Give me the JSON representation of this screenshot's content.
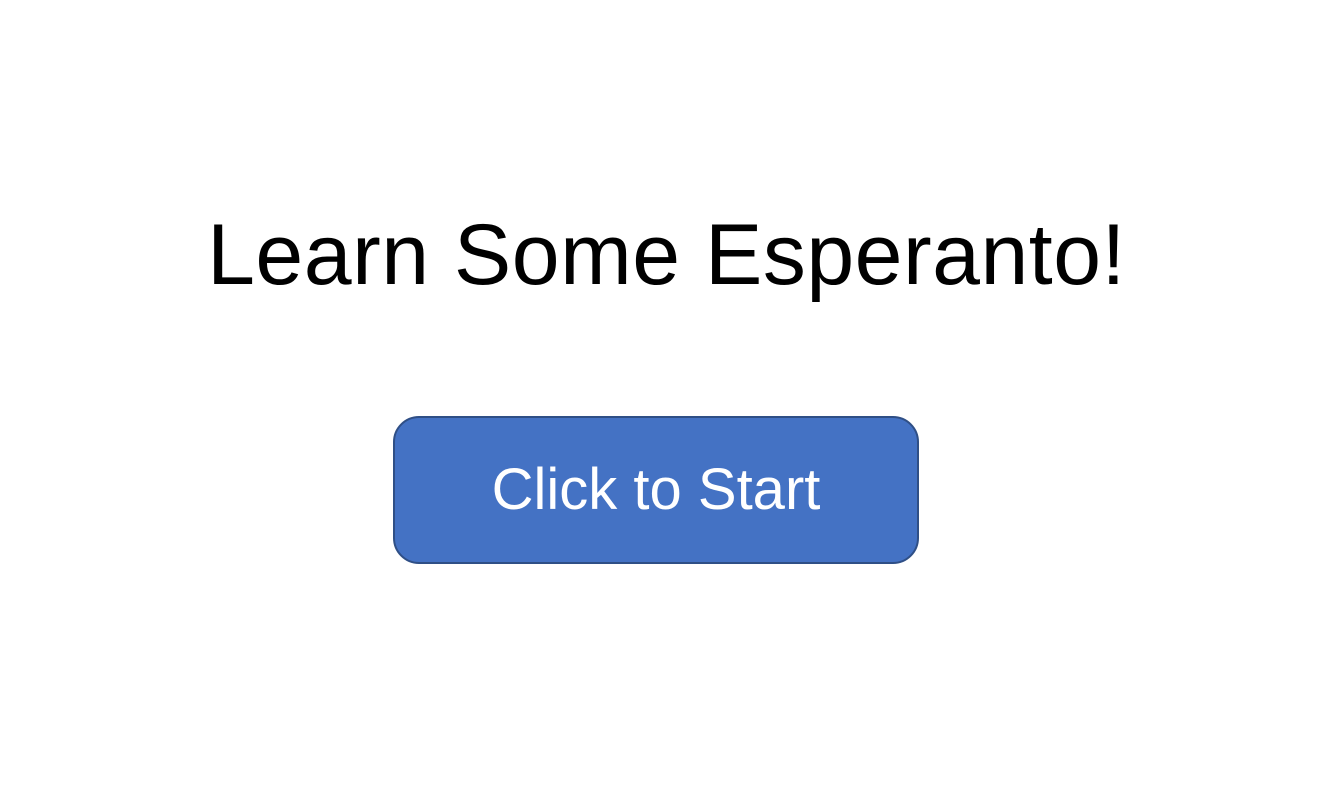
{
  "slide": {
    "title": "Learn Some Esperanto!",
    "start_button_label": "Click to Start"
  },
  "colors": {
    "background": "#ffffff",
    "title_text": "#000000",
    "button_fill": "#4472c4",
    "button_border": "#2f4f86",
    "button_text": "#ffffff"
  }
}
